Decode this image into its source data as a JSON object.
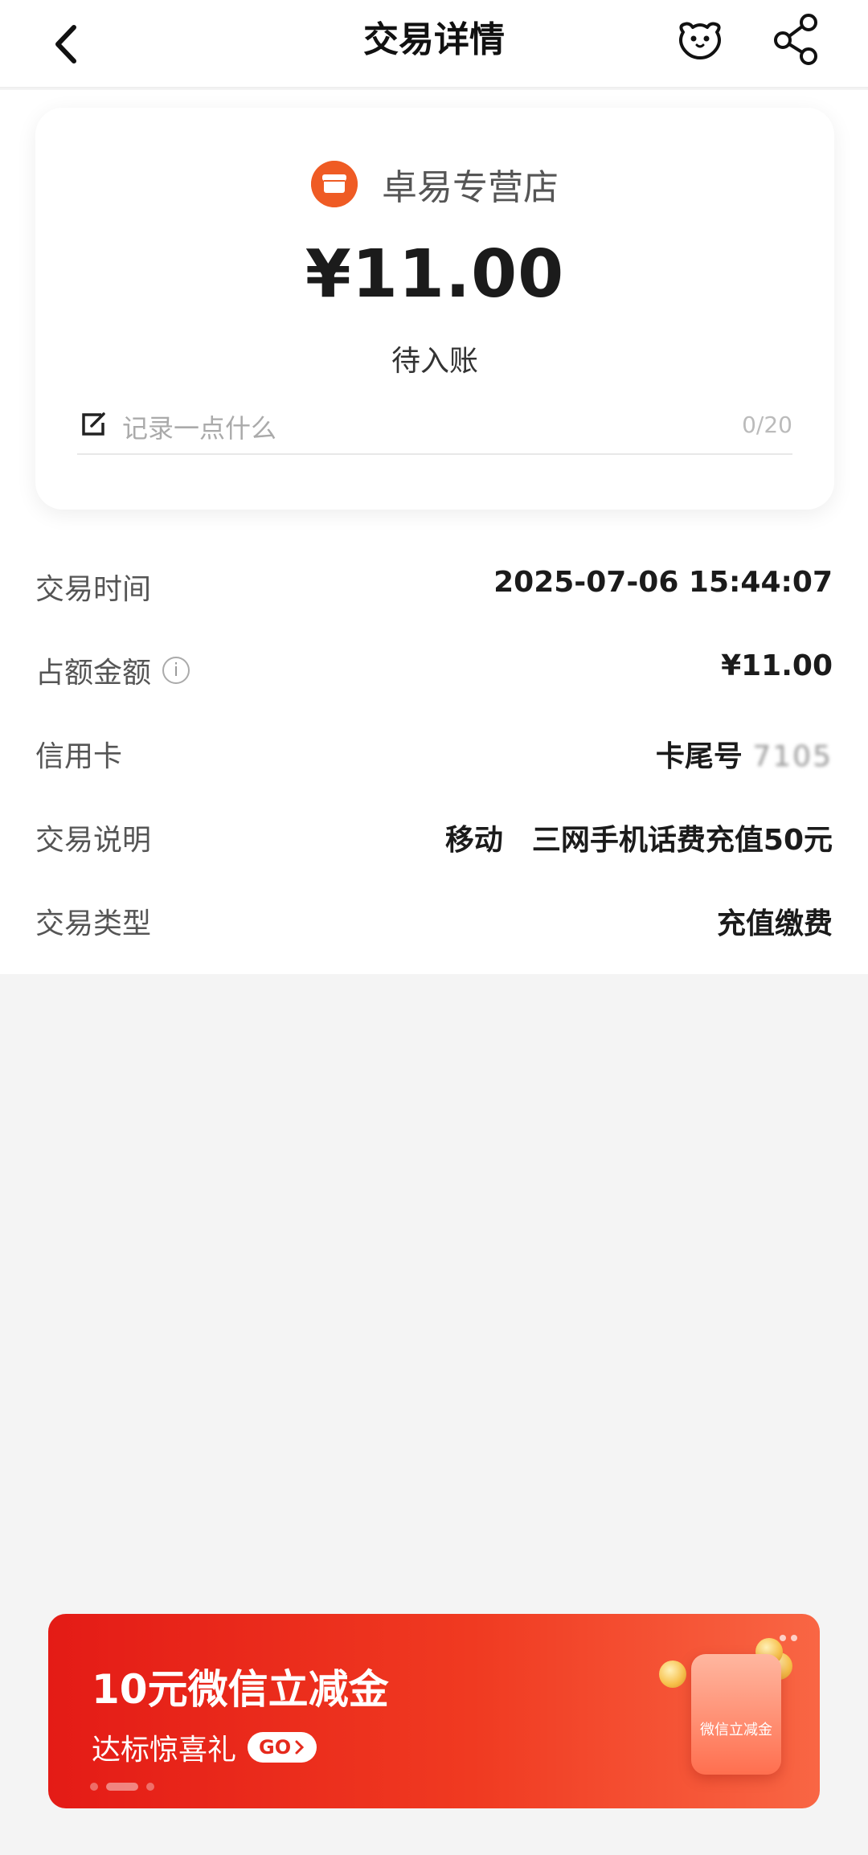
{
  "header": {
    "title": "交易详情",
    "back_icon": "chevron-left-icon",
    "pet_icon": "pet-face-icon",
    "share_icon": "share-icon"
  },
  "card": {
    "store_icon": "store-icon",
    "store_name": "卓易专营店",
    "amount": "¥11.00",
    "status": "待入账",
    "note_placeholder": "记录一点什么",
    "note_count": "0/20",
    "note_icon": "edit-icon"
  },
  "details": {
    "rows": [
      {
        "label": "交易时间",
        "value": "2025-07-06 15:44:07"
      },
      {
        "label": "占额金额",
        "value": "¥11.00",
        "info_icon": "info-icon"
      },
      {
        "label": "信用卡",
        "value_prefix": "卡尾号",
        "value_masked": "7105"
      },
      {
        "label": "交易说明",
        "value": "移动　三网手机话费充值50元"
      },
      {
        "label": "交易类型",
        "value": "充值缴费"
      }
    ]
  },
  "banner": {
    "title": "10元微信立减金",
    "subtitle": "达标惊喜礼",
    "go_label": "GO",
    "envelope_label": "微信立减金"
  },
  "colors": {
    "brand_orange": "#ef5b24",
    "banner_red": "#e41b16"
  }
}
